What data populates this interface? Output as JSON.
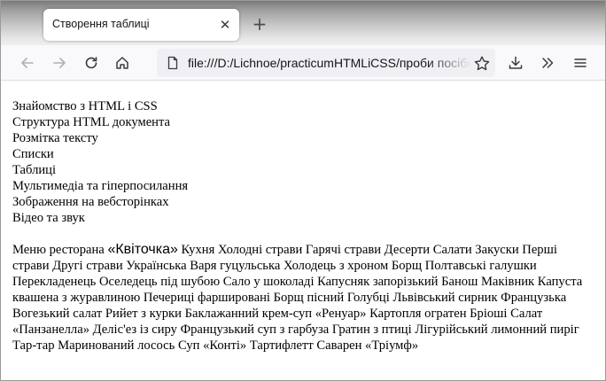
{
  "tab": {
    "title": "Створення таблиці",
    "close_glyph": "✕",
    "new_tab_glyph": "+"
  },
  "toolbar": {
    "back_icon": "back-arrow-icon",
    "forward_icon": "forward-arrow-icon",
    "reload_icon": "reload-icon",
    "home_icon": "home-icon",
    "url": "file:///D:/Lichnoe/practicumHTMLiCSS/проби посібн",
    "bookmark_icon": "star-icon",
    "download_icon": "download-icon",
    "overflow_icon": "chevrons-right-icon",
    "menu_icon": "hamburger-menu-icon"
  },
  "toc": [
    "Знайомство з HTML і CSS",
    "Структура HTML документа",
    "Розмітка тексту",
    "Списки",
    "Таблиці",
    "Мультимедіа та гіперпосилання",
    "Зображення на вебсторінках",
    "Відео та звук"
  ],
  "menu": {
    "prefix": "Меню ресторана ",
    "name": "«Квіточка»",
    "items": "Кухня Холодні страви Гарячі страви Десерти Салати Закуски Перші страви Другі страви Українська Варя гуцульська Холодець з хроном Борщ Полтавські галушки Перекладенець Оселедець під шубою Сало у шоколаді Капусняк запорізький Банош Маківник Капуста квашена з журавлиною Печериці фаршировані Борщ пісний Голубці Львівський сирник Французька Вогезький салат Рийет з курки Баклажанний крем-суп «Ренуар» Картопля огратен Бріоші Салат «Панзанелла» Деліс'ез із сиру Французький суп з гарбуза Гратин з птиці Лігурійський лимонний пиріг Тар-тар Маринований лосось Суп «Конті» Тартифлетт Саварен «Тріумф»"
  }
}
